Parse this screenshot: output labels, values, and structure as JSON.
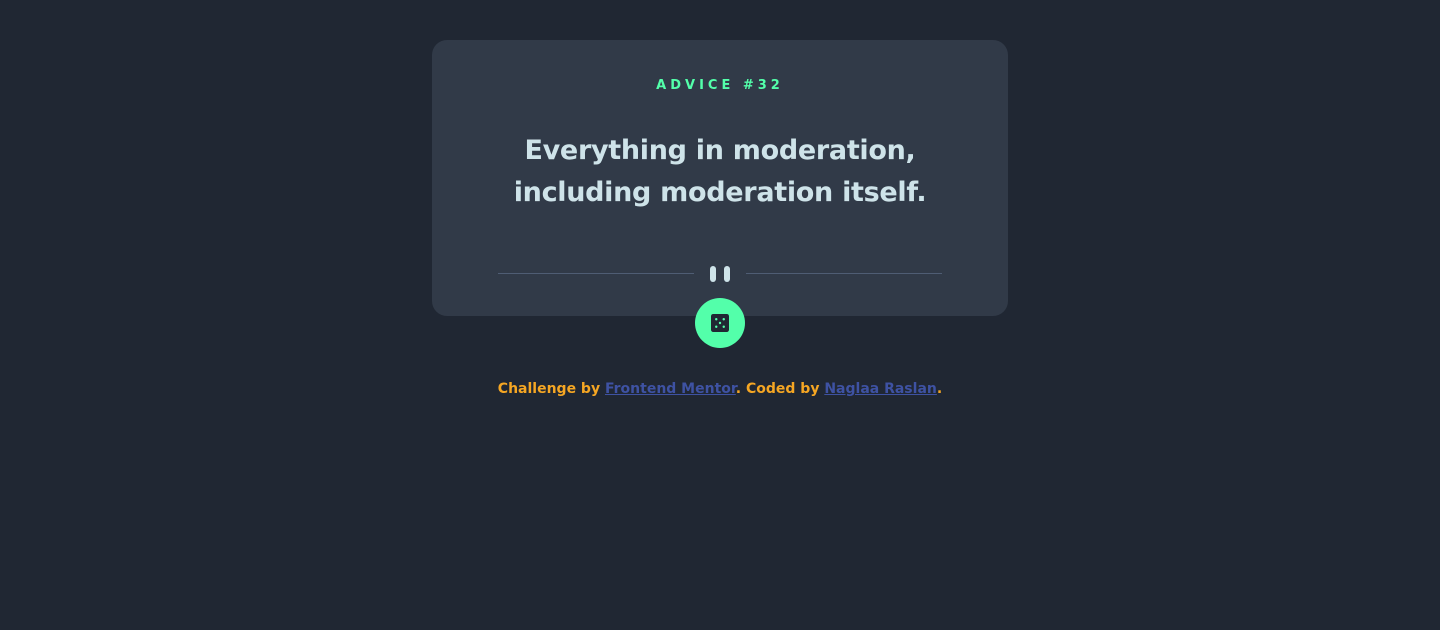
{
  "card": {
    "advice_label": "ADVICE #32",
    "quote": "Everything in moderation, including moderation itself."
  },
  "dice_button": {
    "icon": "dice-icon"
  },
  "attribution": {
    "challenge_prefix": "Challenge by",
    "frontend_mentor_link": "Frontend Mentor",
    "coded_prefix": ". Coded by",
    "author_link": "Naglaa Raslan",
    "period": "."
  },
  "colors": {
    "background": "#202733",
    "card": "#313A48",
    "accent_green": "#53FFAA",
    "quote_text": "#CEE3E9",
    "divider": "#4F5D74",
    "attribution_text": "#F5A623",
    "link": "#3E52A3"
  }
}
